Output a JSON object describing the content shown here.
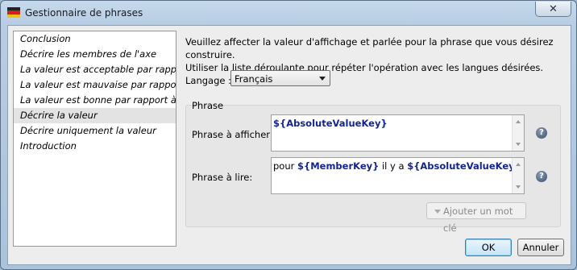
{
  "window": {
    "title": "Gestionnaire de phrases",
    "close_glyph": "✕"
  },
  "list": {
    "items": [
      "Conclusion",
      "Décrire les membres de l'axe",
      "La valeur est acceptable par rapp…",
      "La valeur est mauvaise par rappor…",
      "La valeur est bonne par rapport à …",
      "Décrire la valeur",
      "Décrire uniquement la valeur",
      "Introduction"
    ],
    "selected": "Décrire la valeur"
  },
  "intro": {
    "line1": "Veuillez affecter la valeur d'affichage et parlée pour la phrase que vous désirez construire.",
    "line2": "Utiliser la liste déroulante pour répéter l'opération avec les langues désirées."
  },
  "language": {
    "label": "Langage :",
    "value": "Français"
  },
  "phrase": {
    "group_title": "Phrase",
    "display_label": "Phrase à afficher :",
    "display_token": "${AbsoluteValueKey}",
    "read_label": "Phrase à lire:",
    "read_prefix": "pour ",
    "read_token1": "${MemberKey}",
    "read_middle": " il y a ",
    "read_token2": "${AbsoluteValueKey}",
    "help_glyph": "?",
    "add_keyword": "Ajouter un mot clé"
  },
  "buttons": {
    "ok": "OK",
    "cancel": "Annuler"
  },
  "icons": {
    "app": "flag-icon",
    "close": "close-icon",
    "dropdown": "chevron-down-icon",
    "help": "help-icon"
  },
  "colors": {
    "token": "#14248f",
    "selection": "#e3e3e3"
  }
}
